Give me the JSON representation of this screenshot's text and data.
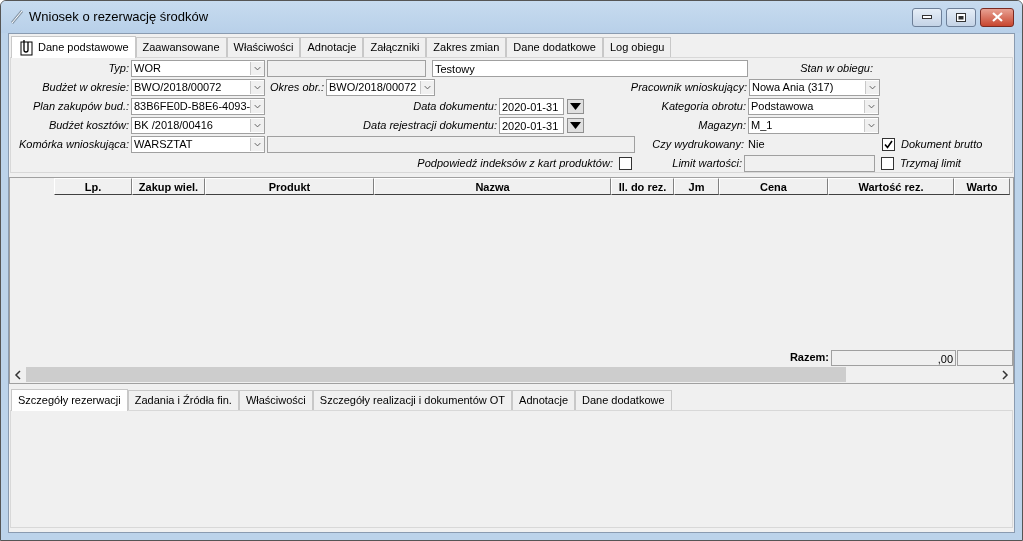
{
  "window": {
    "title": "Wniosek o rezerwację środków"
  },
  "tabs": [
    {
      "label": "Dane podstawowe",
      "selected": true
    },
    {
      "label": "Zaawansowane",
      "selected": false
    },
    {
      "label": "Właściwości",
      "selected": false
    },
    {
      "label": "Adnotacje",
      "selected": false
    },
    {
      "label": "Załączniki",
      "selected": false
    },
    {
      "label": "Zakres zmian",
      "selected": false
    },
    {
      "label": "Dane dodatkowe",
      "selected": false
    },
    {
      "label": "Log obiegu",
      "selected": false
    }
  ],
  "form": {
    "typ": {
      "label": "Typ:",
      "value": "WOR"
    },
    "opis": {
      "value": "Testowy"
    },
    "stan": {
      "label": "Stan w obiegu:"
    },
    "budzet_w_okresie": {
      "label": "Budżet w okresie:",
      "value": "BWO/2018/00072"
    },
    "okres_obr": {
      "label": "Okres obr.:",
      "value": "BWO/2018/00072"
    },
    "pracownik": {
      "label": "Pracownik wnioskujący:",
      "value": "Nowa Ania (317)"
    },
    "plan_zakupow": {
      "label": "Plan zakupów bud.:",
      "value": "83B6FE0D-B8E6-4093-"
    },
    "data_dokumentu": {
      "label": "Data dokumentu:",
      "value": "2020-01-31"
    },
    "kategoria": {
      "label": "Kategoria obrotu:",
      "value": "Podstawowa"
    },
    "budzet_kosztow": {
      "label": "Budżet kosztów:",
      "value": "BK /2018/00416"
    },
    "data_rejestracji": {
      "label": "Data rejestracji dokumentu:",
      "value": "2020-01-31"
    },
    "magazyn": {
      "label": "Magazyn:",
      "value": "M_1"
    },
    "komorka": {
      "label": "Komórka wnioskująca:",
      "value": "WARSZTAT"
    },
    "czy_wydrukowany": {
      "label": "Czy wydrukowany:",
      "value": "Nie"
    },
    "dokument_brutto": {
      "label": "Dokument brutto",
      "checked": true
    },
    "podpowiedz": {
      "label": "Podpowiedź indeksów z kart produktów:",
      "checked": false
    },
    "limit": {
      "label": "Limit wartości:"
    },
    "trzymaj_limit": {
      "label": "Trzymaj limit",
      "checked": false
    }
  },
  "table": {
    "columns": [
      "Lp.",
      "Zakup wiel.",
      "Produkt",
      "Nazwa",
      "Il. do rez.",
      "Jm",
      "Cena",
      "Wartość rez.",
      "Warto"
    ],
    "total_label": "Razem:",
    "totals": [
      ",00"
    ]
  },
  "bottom_tabs": [
    {
      "label": "Szczegóły rezerwacji",
      "selected": true
    },
    {
      "label": "Zadania i Źródła fin.",
      "selected": false
    },
    {
      "label": "Właściwości",
      "selected": false
    },
    {
      "label": "Szczegóły realizacji i dokumentów OT",
      "selected": false
    },
    {
      "label": "Adnotacje",
      "selected": false
    },
    {
      "label": "Dane dodatkowe",
      "selected": false
    }
  ]
}
